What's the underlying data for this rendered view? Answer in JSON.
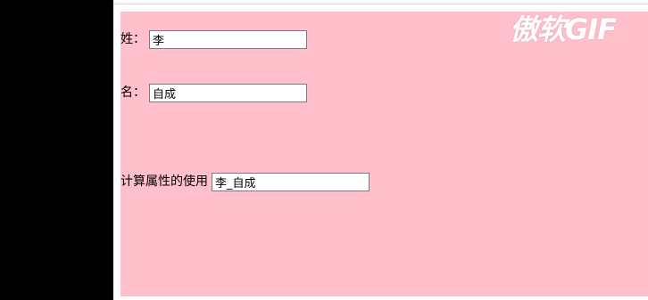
{
  "form": {
    "last_name_label": "姓",
    "last_name_sep": "：",
    "last_name_value": "李",
    "first_name_label": "名",
    "first_name_sep": "：",
    "first_name_value": "自成",
    "full_name_label": "计算属性的使用",
    "full_name_value": "李_自成"
  },
  "watermark": "傲软GIF",
  "colors": {
    "panel_bg": "#ffc0cb",
    "left_bar": "#000000"
  }
}
